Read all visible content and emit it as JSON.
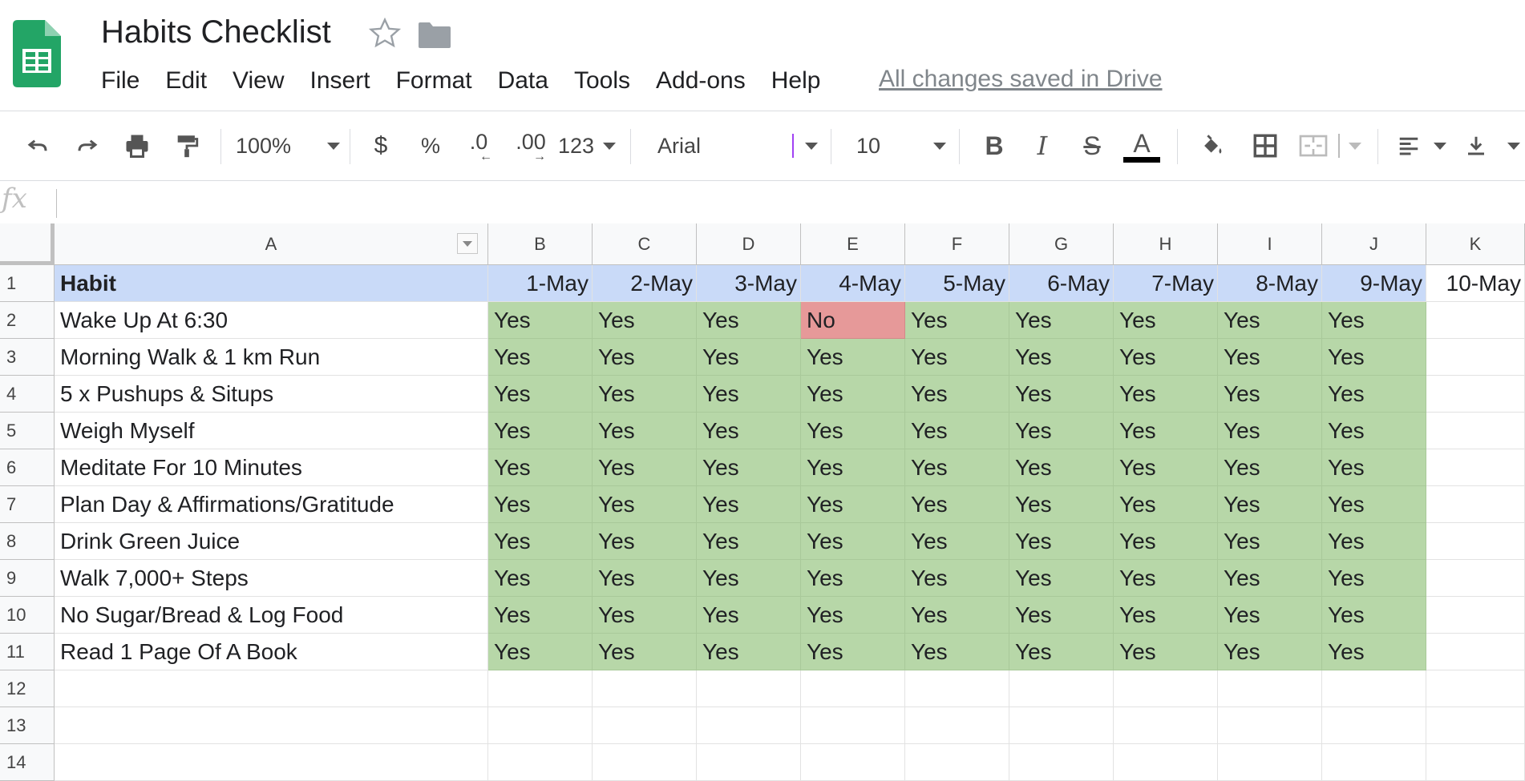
{
  "app": {
    "title": "Habits Checklist",
    "save_status": "All changes saved in Drive",
    "logo_icon": "sheets-logo-icon",
    "star_icon": "star-icon",
    "folder_icon": "folder-icon"
  },
  "menu": [
    "File",
    "Edit",
    "View",
    "Insert",
    "Format",
    "Data",
    "Tools",
    "Add-ons",
    "Help"
  ],
  "toolbar": {
    "zoom": "100%",
    "currency": "$",
    "percent": "%",
    "decrease_decimal": ".0",
    "increase_decimal": ".00",
    "more_formats": "123",
    "font": "Arial",
    "font_size": "10",
    "icons": [
      "undo-icon",
      "redo-icon",
      "print-icon",
      "paint-format-icon",
      "bold-icon",
      "italic-icon",
      "strikethrough-icon",
      "text-color-icon",
      "fill-color-icon",
      "borders-icon",
      "merge-cells-icon",
      "align-left-icon",
      "vertical-align-icon"
    ]
  },
  "formula_bar": {
    "label": "fx",
    "value": ""
  },
  "columns": [
    "A",
    "B",
    "C",
    "D",
    "E",
    "F",
    "G",
    "H",
    "I",
    "J",
    "K"
  ],
  "rows": [
    {
      "num": "1",
      "habit": "Habit",
      "values": [
        "1-May",
        "2-May",
        "3-May",
        "4-May",
        "5-May",
        "6-May",
        "7-May",
        "8-May",
        "9-May",
        "10-May"
      ]
    },
    {
      "num": "2",
      "habit": "Wake Up At 6:30",
      "values": [
        "Yes",
        "Yes",
        "Yes",
        "No",
        "Yes",
        "Yes",
        "Yes",
        "Yes",
        "Yes",
        ""
      ]
    },
    {
      "num": "3",
      "habit": "Morning Walk & 1 km Run",
      "values": [
        "Yes",
        "Yes",
        "Yes",
        "Yes",
        "Yes",
        "Yes",
        "Yes",
        "Yes",
        "Yes",
        ""
      ]
    },
    {
      "num": "4",
      "habit": "5 x Pushups & Situps",
      "values": [
        "Yes",
        "Yes",
        "Yes",
        "Yes",
        "Yes",
        "Yes",
        "Yes",
        "Yes",
        "Yes",
        ""
      ]
    },
    {
      "num": "5",
      "habit": "Weigh Myself",
      "values": [
        "Yes",
        "Yes",
        "Yes",
        "Yes",
        "Yes",
        "Yes",
        "Yes",
        "Yes",
        "Yes",
        ""
      ]
    },
    {
      "num": "6",
      "habit": "Meditate For 10 Minutes",
      "values": [
        "Yes",
        "Yes",
        "Yes",
        "Yes",
        "Yes",
        "Yes",
        "Yes",
        "Yes",
        "Yes",
        ""
      ]
    },
    {
      "num": "7",
      "habit": "Plan Day & Affirmations/Gratitude",
      "values": [
        "Yes",
        "Yes",
        "Yes",
        "Yes",
        "Yes",
        "Yes",
        "Yes",
        "Yes",
        "Yes",
        ""
      ]
    },
    {
      "num": "8",
      "habit": "Drink Green Juice",
      "values": [
        "Yes",
        "Yes",
        "Yes",
        "Yes",
        "Yes",
        "Yes",
        "Yes",
        "Yes",
        "Yes",
        ""
      ]
    },
    {
      "num": "9",
      "habit": "Walk 7,000+ Steps",
      "values": [
        "Yes",
        "Yes",
        "Yes",
        "Yes",
        "Yes",
        "Yes",
        "Yes",
        "Yes",
        "Yes",
        ""
      ]
    },
    {
      "num": "10",
      "habit": "No Sugar/Bread & Log Food",
      "values": [
        "Yes",
        "Yes",
        "Yes",
        "Yes",
        "Yes",
        "Yes",
        "Yes",
        "Yes",
        "Yes",
        ""
      ]
    },
    {
      "num": "11",
      "habit": "Read 1 Page Of A Book",
      "values": [
        "Yes",
        "Yes",
        "Yes",
        "Yes",
        "Yes",
        "Yes",
        "Yes",
        "Yes",
        "Yes",
        ""
      ]
    },
    {
      "num": "12",
      "habit": "",
      "values": [
        "",
        "",
        "",
        "",
        "",
        "",
        "",
        "",
        "",
        ""
      ]
    },
    {
      "num": "13",
      "habit": "",
      "values": [
        "",
        "",
        "",
        "",
        "",
        "",
        "",
        "",
        "",
        ""
      ]
    },
    {
      "num": "14",
      "habit": "",
      "values": [
        "",
        "",
        "",
        "",
        "",
        "",
        "",
        "",
        "",
        ""
      ]
    }
  ],
  "colors": {
    "header_fill": "#c9daf8",
    "yes_fill": "#b7d7a8",
    "no_fill": "#e69999",
    "logo_green": "#0f9d58"
  }
}
